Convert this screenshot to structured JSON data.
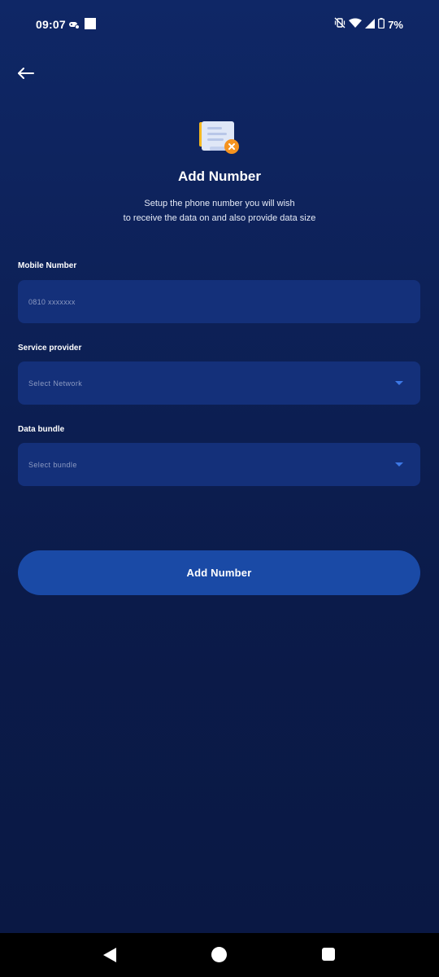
{
  "status_bar": {
    "time": "09:07",
    "battery_text": "7%"
  },
  "header": {
    "back_icon": "arrow-left-icon"
  },
  "title": "Add Number",
  "subtitle_lines": [
    "Setup the phone number you will wish",
    "to receive the data on and also provide data size"
  ],
  "form": {
    "mobile_number": {
      "label": "Mobile Number",
      "value": "",
      "placeholder": "0810 xxxxxxx"
    },
    "service_provider": {
      "label": "Service provider",
      "selected": "Select Network"
    },
    "data_bundle": {
      "label": "Data bundle",
      "selected": "Select bundle"
    }
  },
  "submit_label": "Add Number",
  "colors": {
    "background_top": "#0f2766",
    "background_bottom": "#0a1843",
    "field_background": "#14307a",
    "button_background": "#1a4aa6",
    "dropdown_accent": "#3d78e6"
  },
  "nav_icons": [
    "back-triangle-icon",
    "home-circle-icon",
    "recents-square-icon"
  ]
}
